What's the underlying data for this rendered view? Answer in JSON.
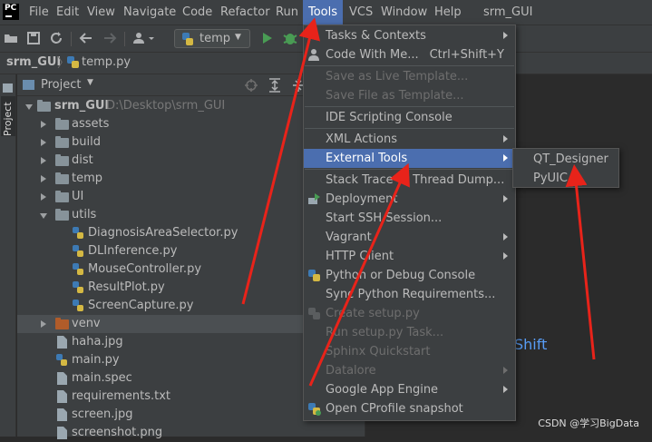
{
  "app": {
    "logo_text": "PC",
    "project_name": "srm_GUI"
  },
  "menubar": {
    "items": [
      {
        "label": "File",
        "mn": "F",
        "rest": "ile"
      },
      {
        "label": "Edit",
        "mn": "E",
        "rest": "dit"
      },
      {
        "label": "View",
        "mn": "V",
        "rest": "iew"
      },
      {
        "label": "Navigate",
        "mn": "N",
        "rest": "avigate"
      },
      {
        "label": "Code",
        "mn": "C",
        "rest": "ode"
      },
      {
        "label": "Refactor",
        "mn": "R",
        "rest": "efactor"
      },
      {
        "label": "Run",
        "pre": "R",
        "mn": "u",
        "rest": "n"
      },
      {
        "label": "Tools",
        "mn": "T",
        "rest": "ools"
      },
      {
        "label": "VCS",
        "pre": "VC",
        "mn": "S",
        "rest": ""
      },
      {
        "label": "Window",
        "mn": "W",
        "rest": "indow"
      },
      {
        "label": "Help",
        "mn": "H",
        "rest": "elp"
      }
    ],
    "active": "Tools",
    "window_title": "srm_GUI"
  },
  "toolbar": {
    "run_config": "temp"
  },
  "breadcrumb": {
    "root": "srm_GUI",
    "file": "temp.py"
  },
  "sidetab": {
    "label": "Project"
  },
  "project_panel": {
    "title": "Project",
    "root": {
      "name": "srm_GUI",
      "path": "D:\\Desktop\\srm_GUI"
    },
    "items": [
      {
        "name": "assets",
        "type": "folder",
        "depth": 1,
        "expanded": false
      },
      {
        "name": "build",
        "type": "folder",
        "depth": 1,
        "expanded": false
      },
      {
        "name": "dist",
        "type": "folder",
        "depth": 1,
        "expanded": false
      },
      {
        "name": "temp",
        "type": "folder",
        "depth": 1,
        "expanded": false
      },
      {
        "name": "UI",
        "type": "folder",
        "depth": 1,
        "expanded": false
      },
      {
        "name": "utils",
        "type": "folder",
        "depth": 1,
        "expanded": true
      },
      {
        "name": "DiagnosisAreaSelector.py",
        "type": "py",
        "depth": 2
      },
      {
        "name": "DLInference.py",
        "type": "py",
        "depth": 2
      },
      {
        "name": "MouseController.py",
        "type": "py",
        "depth": 2
      },
      {
        "name": "ResultPlot.py",
        "type": "py",
        "depth": 2
      },
      {
        "name": "ScreenCapture.py",
        "type": "py",
        "depth": 2
      },
      {
        "name": "venv",
        "type": "folder-orange",
        "depth": 1,
        "expanded": false,
        "selected": true
      },
      {
        "name": "haha.jpg",
        "type": "file",
        "depth": 1
      },
      {
        "name": "main.py",
        "type": "py",
        "depth": 1
      },
      {
        "name": "main.spec",
        "type": "file",
        "depth": 1
      },
      {
        "name": "requirements.txt",
        "type": "file",
        "depth": 1
      },
      {
        "name": "screen.jpg",
        "type": "file",
        "depth": 1
      },
      {
        "name": "screenshot.png",
        "type": "file",
        "depth": 1
      }
    ]
  },
  "tools_menu": {
    "items": [
      {
        "label": "Tasks & Contexts",
        "submenu": true
      },
      {
        "label": "Code With Me...",
        "shortcut": "Ctrl+Shift+Y",
        "icon": "user-icon"
      },
      {
        "sep": true
      },
      {
        "label": "Save as Live Template...",
        "disabled": true
      },
      {
        "label": "Save File as Template...",
        "disabled": true
      },
      {
        "sep": true
      },
      {
        "label": "IDE Scripting Console"
      },
      {
        "sep": true
      },
      {
        "label": "XML Actions",
        "submenu": true
      },
      {
        "label": "External Tools",
        "submenu": true,
        "highlighted": true
      },
      {
        "sep": true
      },
      {
        "label": "Stack Trace or Thread Dump..."
      },
      {
        "label": "Deployment",
        "submenu": true,
        "icon": "deployment-icon"
      },
      {
        "label": "Start SSH Session..."
      },
      {
        "label": "Vagrant",
        "submenu": true
      },
      {
        "label": "HTTP Client",
        "submenu": true
      },
      {
        "label": "Python or Debug Console",
        "icon": "python-icon"
      },
      {
        "label": "Sync Python Requirements..."
      },
      {
        "label": "Create setup.py",
        "disabled": true,
        "icon": "setup-icon"
      },
      {
        "label": "Run setup.py Task...",
        "disabled": true
      },
      {
        "label": "Sphinx Quickstart",
        "disabled": true
      },
      {
        "label": "Datalore",
        "submenu": true,
        "disabled": true
      },
      {
        "label": "Google App Engine",
        "submenu": true
      },
      {
        "label": "Open CProfile snapshot",
        "icon": "cprofile-icon"
      }
    ]
  },
  "external_tools_submenu": {
    "items": [
      "QT_Designer",
      "PyUIC"
    ]
  },
  "editor": {
    "hint_fragment": "Shift"
  },
  "watermark": "CSDN @学习BigData",
  "colors": {
    "highlight": "#4b6eaf",
    "annotation": "#e8231a"
  }
}
